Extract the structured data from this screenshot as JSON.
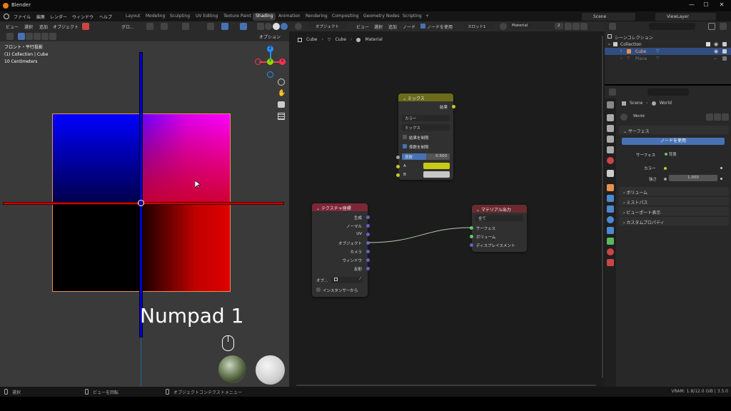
{
  "titlebar": {
    "app_name": "Blender",
    "minimize": "—",
    "maximize": "☐",
    "close": "✕"
  },
  "menu": [
    "ファイル",
    "編集",
    "レンダー",
    "ウィンドウ",
    "ヘルプ"
  ],
  "workspace_tabs": [
    "Layout",
    "Modeling",
    "Sculpting",
    "UV Editing",
    "Texture Paint",
    "Shading",
    "Animation",
    "Rendering",
    "Compositing",
    "Geometry Nodes",
    "Scripting"
  ],
  "workspace_add": "+",
  "active_workspace": "Shading",
  "scene": {
    "label": "Scene",
    "viewlayer": "ViewLayer"
  },
  "viewport": {
    "header": [
      "ビュー",
      "選択",
      "追加",
      "オブジェクト"
    ],
    "shading_label": "グロ...",
    "options_label": "オプション",
    "info_line1": "フロント・平行投影",
    "info_line2": "(1) Collection | Cube",
    "info_line3": "10 Centimeters",
    "overlay_text": "Numpad 1",
    "gizmo": {
      "x": "X",
      "y": "Y",
      "z": "Z"
    }
  },
  "node_editor": {
    "mode": "オブジェクト",
    "menus": [
      "ビュー",
      "選択",
      "追加",
      "ノード"
    ],
    "use_nodes_label": "ノードを使用",
    "slot": "スロット1",
    "material": "Material",
    "users": "2",
    "breadcrumb": [
      "Cube",
      "Cube",
      "Material"
    ]
  },
  "node_mix": {
    "title": "ミックス",
    "output": "結果",
    "data_type": "カラー",
    "blend": "ミックス",
    "clamp_result": "結果を制限",
    "clamp_factor": "係数を制限",
    "factor_label": "係数",
    "factor_value": "0.500",
    "a_label": "A",
    "b_label": "B",
    "a_color": "#c8c816",
    "b_color": "#c8c8c8"
  },
  "node_texcoord": {
    "title": "テクスチャ座標",
    "outputs": [
      "生成",
      "ノーマル",
      "UV",
      "オブジェクト",
      "カメラ",
      "ウィンドウ",
      "反射"
    ],
    "object_label": "オブ...",
    "from_instancer": "インスタンサーから"
  },
  "node_output": {
    "title": "マテリアル出力",
    "target": "全て",
    "inputs": [
      "サーフェス",
      "ボリューム",
      "ディスプレイスメント"
    ]
  },
  "outliner": {
    "root": "シーンコレクション",
    "items": [
      {
        "label": "Collection",
        "selected": false
      },
      {
        "label": "Cube",
        "selected": true
      },
      {
        "label": "Plane",
        "selected": false
      }
    ]
  },
  "properties": {
    "breadcrumb_scene": "Scene",
    "breadcrumb_world": "World",
    "world_name": "World",
    "surface_panel": "サーフェス",
    "use_nodes_button": "ノードを使用",
    "surface_label": "サーフェス",
    "surface_value": "背景",
    "color_label": "カラー",
    "strength_label": "強さ",
    "strength_value": "1.000",
    "panels": [
      "ボリューム",
      "ミストパス",
      "ビューポート表示",
      "カスタムプロパティ"
    ]
  },
  "statusbar": {
    "select": "選択",
    "rotate_view": "ビューを回転",
    "context_menu": "オブジェクトコンテクストメニュー",
    "vram": "VRAM: 1.8/12.0 GiB | 3.5.0"
  },
  "colors": {
    "accent": "#4772b3",
    "x_axis": "#ff3352",
    "y_axis": "#8bdc00",
    "z_axis": "#2890ff",
    "mix_header": "#6b6b1c",
    "input_header": "#7d2638",
    "output_header": "#6b2a2f"
  }
}
